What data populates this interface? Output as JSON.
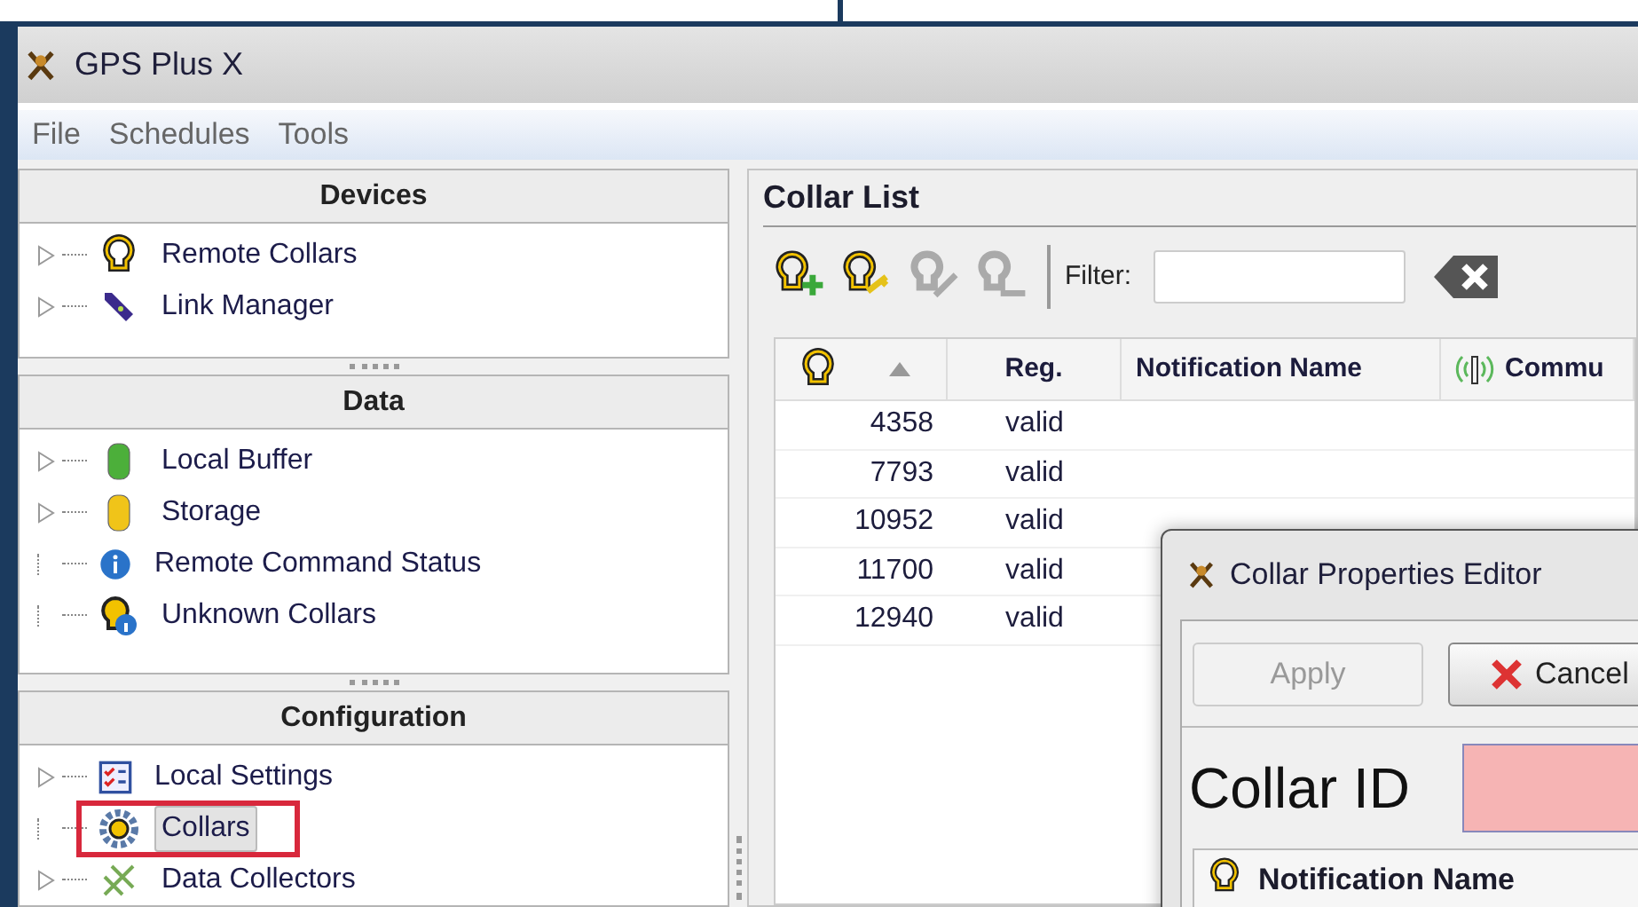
{
  "window": {
    "title": "GPS Plus X"
  },
  "menu": [
    "File",
    "Schedules",
    "Tools"
  ],
  "sidebar": {
    "sections": [
      {
        "title": "Devices",
        "items": [
          {
            "label": "Remote Collars",
            "expandable": true,
            "selected": false,
            "outlined": false
          },
          {
            "label": "Link Manager",
            "expandable": true,
            "selected": false,
            "outlined": false
          }
        ]
      },
      {
        "title": "Data",
        "items": [
          {
            "label": "Local Buffer",
            "expandable": true,
            "selected": false,
            "outlined": false
          },
          {
            "label": "Storage",
            "expandable": true,
            "selected": false,
            "outlined": false
          },
          {
            "label": "Remote Command Status",
            "expandable": false,
            "selected": false,
            "outlined": false
          },
          {
            "label": "Unknown Collars",
            "expandable": false,
            "selected": false,
            "outlined": false
          }
        ]
      },
      {
        "title": "Configuration",
        "items": [
          {
            "label": "Local Settings",
            "expandable": true,
            "selected": false,
            "outlined": false
          },
          {
            "label": "Collars",
            "expandable": false,
            "selected": true,
            "outlined": true
          },
          {
            "label": "Data Collectors",
            "expandable": true,
            "selected": false,
            "outlined": false
          }
        ]
      }
    ]
  },
  "collar_list": {
    "title": "Collar List",
    "toolbar": {
      "buttons": [
        {
          "disabled": false
        },
        {
          "disabled": false
        },
        {
          "disabled": true
        },
        {
          "disabled": true
        }
      ],
      "filter_label": "Filter:"
    },
    "table": {
      "columns": [
        "Reg.",
        "Notification Name",
        "Commu"
      ],
      "rows": [
        {
          "id": "4358",
          "reg": "valid"
        },
        {
          "id": "7793",
          "reg": "valid"
        },
        {
          "id": "10952",
          "reg": "valid"
        },
        {
          "id": "11700",
          "reg": "valid"
        },
        {
          "id": "12940",
          "reg": "valid"
        }
      ]
    }
  },
  "dialog": {
    "title": "Collar Properties Editor",
    "buttons": [
      {
        "label": "Apply",
        "disabled": true
      },
      {
        "label": "Cancel",
        "disabled": false
      }
    ],
    "collar_id_label": "Collar ID",
    "collar_id_invalid": true,
    "table_header": "Notification Name"
  }
}
